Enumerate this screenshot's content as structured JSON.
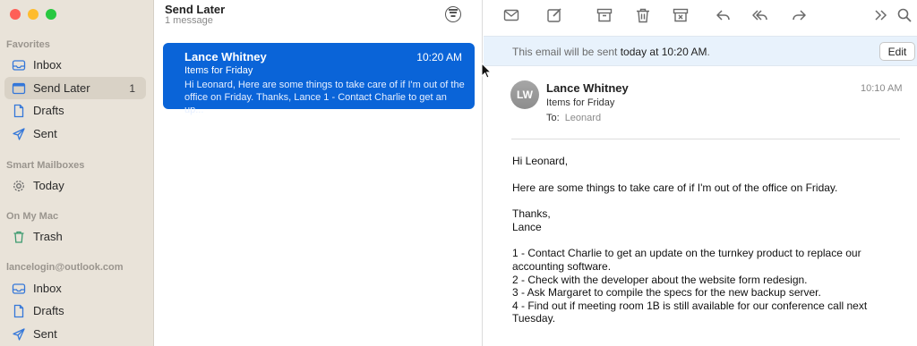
{
  "sidebar": {
    "sections": {
      "favorites": "Favorites",
      "smart": "Smart Mailboxes",
      "onmymac": "On My Mac",
      "account": "lancelogin@outlook.com"
    },
    "items": [
      {
        "label": "Inbox",
        "icon": "inbox-icon"
      },
      {
        "label": "Send Later",
        "icon": "send-later-icon",
        "count": "1"
      },
      {
        "label": "Drafts",
        "icon": "drafts-icon"
      },
      {
        "label": "Sent",
        "icon": "sent-icon"
      },
      {
        "label": "Today",
        "icon": "gear-icon"
      },
      {
        "label": "Trash",
        "icon": "trash-icon"
      },
      {
        "label": "Inbox",
        "icon": "inbox-icon"
      },
      {
        "label": "Drafts",
        "icon": "drafts-icon"
      },
      {
        "label": "Sent",
        "icon": "sent-icon"
      }
    ],
    "selected_color": "#d9d2c6",
    "icon_color": "#3477d9"
  },
  "list": {
    "title": "Send Later",
    "subtitle": "1 message",
    "message": {
      "from": "Lance Whitney",
      "time": "10:20 AM",
      "subject": "Items for Friday",
      "preview": "Hi Leonard, Here are some things to take care of if I'm out of the office on Friday. Thanks, Lance 1 - Contact Charlie to get an up..."
    },
    "accent": "#0a64d8"
  },
  "viewer": {
    "banner": {
      "prefix": "This email will be sent ",
      "when": "today at 10:20 AM",
      "suffix": ".",
      "edit_label": "Edit"
    },
    "mail": {
      "avatar": "LW",
      "sender": "Lance Whitney",
      "time": "10:10 AM",
      "subject": "Items for Friday",
      "to_label": "To:",
      "to_name": "Leonard"
    },
    "body": {
      "greeting": "Hi Leonard,",
      "intro": "Here are some things to take care of if I'm out of the office on Friday.",
      "signoff1": "Thanks,",
      "signoff2": "Lance",
      "item1": "1 - Contact Charlie to get an update on the turnkey product to replace our accounting software.",
      "item2": "2 - Check with the developer about the website form redesign.",
      "item3": "3 - Ask Margaret to compile the specs for the new backup server.",
      "item4": "4 - Find out if meeting room 1B is still available for our conference call next Tuesday."
    }
  },
  "toolbar_icons": [
    "new-message-icon",
    "compose-icon",
    "archive-icon",
    "trash-icon",
    "junk-icon",
    "reply-icon",
    "reply-all-icon",
    "forward-icon",
    "more-icon",
    "search-icon"
  ]
}
